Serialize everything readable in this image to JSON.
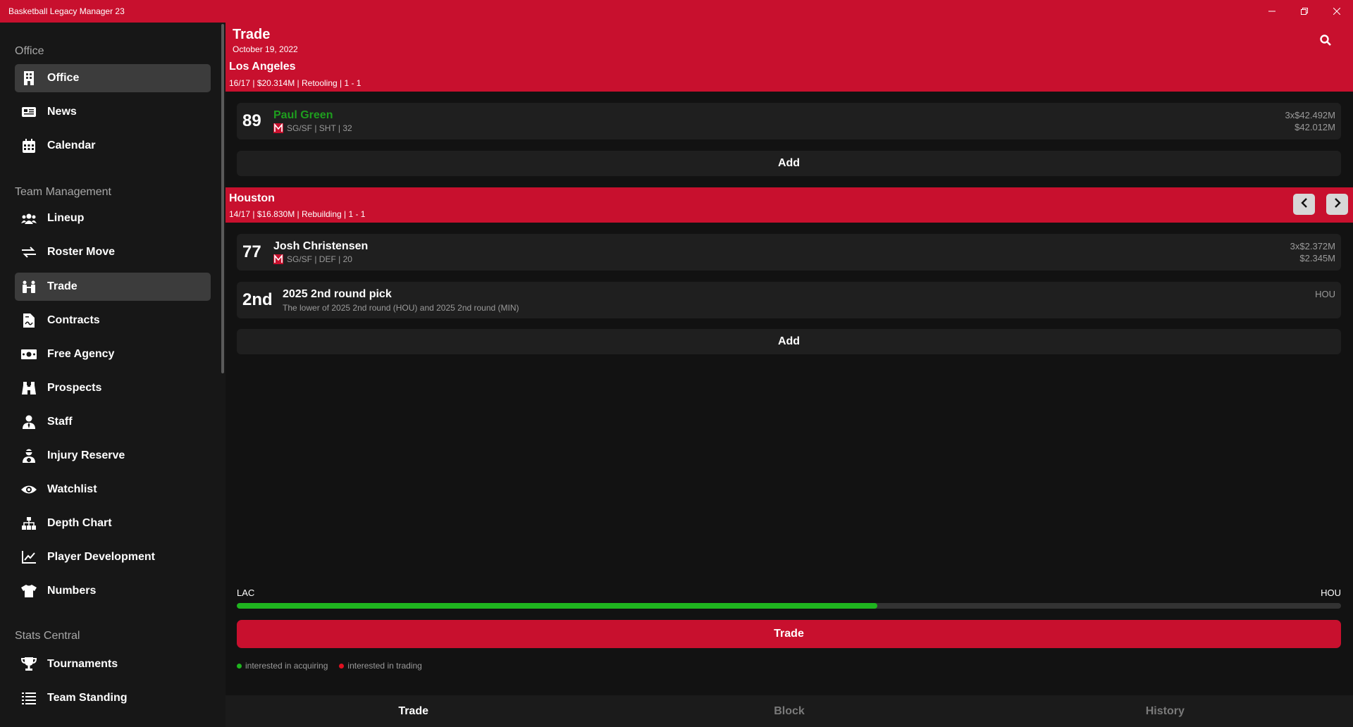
{
  "window": {
    "title": "Basketball Legacy Manager 23"
  },
  "sidebar": {
    "sections": [
      {
        "title": "Office"
      },
      {
        "title": "Team Management"
      },
      {
        "title": "Stats Central"
      }
    ],
    "items": [
      {
        "label": "Office",
        "icon": "building-icon"
      },
      {
        "label": "News",
        "icon": "newspaper-icon"
      },
      {
        "label": "Calendar",
        "icon": "calendar-icon"
      },
      {
        "label": "Lineup",
        "icon": "users-icon"
      },
      {
        "label": "Roster Move",
        "icon": "exchange-icon"
      },
      {
        "label": "Trade",
        "icon": "handshake-icon"
      },
      {
        "label": "Contracts",
        "icon": "contract-icon"
      },
      {
        "label": "Free Agency",
        "icon": "money-icon"
      },
      {
        "label": "Prospects",
        "icon": "binoculars-icon"
      },
      {
        "label": "Staff",
        "icon": "person-tie-icon"
      },
      {
        "label": "Injury Reserve",
        "icon": "injured-icon"
      },
      {
        "label": "Watchlist",
        "icon": "eye-icon"
      },
      {
        "label": "Depth Chart",
        "icon": "sitemap-icon"
      },
      {
        "label": "Player Development",
        "icon": "chart-line-icon"
      },
      {
        "label": "Numbers",
        "icon": "jersey-icon"
      },
      {
        "label": "Tournaments",
        "icon": "trophy-icon"
      },
      {
        "label": "Team Standing",
        "icon": "list-icon"
      }
    ],
    "active": [
      "Office",
      "Trade"
    ]
  },
  "header": {
    "title": "Trade",
    "date": "October 19, 2022"
  },
  "team1": {
    "name": "Los Angeles",
    "info": "16/17 | $20.314M | Retooling | 1 - 1",
    "players": [
      {
        "ovr": "89",
        "name": "Paul Green",
        "meta": "SG/SF | SHT | 32",
        "contract": "3x$42.492M",
        "salary": "$42.012M"
      }
    ],
    "add_label": "Add"
  },
  "team2": {
    "name": "Houston",
    "info": "14/17 | $16.830M | Rebuilding | 1 - 1",
    "players": [
      {
        "ovr": "77",
        "name": "Josh Christensen",
        "meta": "SG/SF | DEF | 20",
        "contract": "3x$2.372M",
        "salary": "$2.345M"
      }
    ],
    "picks": [
      {
        "round": "2nd",
        "title": "2025 2nd round pick",
        "desc": "The lower of 2025 2nd round (HOU) and 2025 2nd round (MIN)",
        "team": "HOU"
      }
    ],
    "add_label": "Add"
  },
  "balance": {
    "left": "LAC",
    "right": "HOU",
    "value": 0.58,
    "color": "#1fb51f"
  },
  "trade_button": "Trade",
  "legend": [
    {
      "label": "interested in acquiring",
      "color": "#1fb51f"
    },
    {
      "label": "interested in trading",
      "color": "#e01020"
    }
  ],
  "tabs": [
    {
      "label": "Trade",
      "active": true
    },
    {
      "label": "Block",
      "active": false
    },
    {
      "label": "History",
      "active": false
    }
  ],
  "colors": {
    "accent": "#c8102e",
    "background": "#121212",
    "sidebar": "#171717",
    "card": "#1f1f1f"
  }
}
